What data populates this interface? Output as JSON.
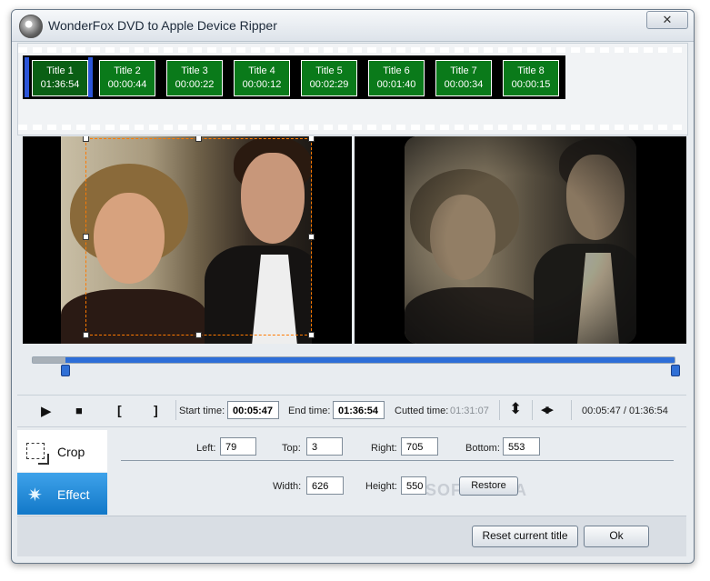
{
  "window": {
    "title": "WonderFox DVD to Apple Device Ripper",
    "close_glyph": "✕"
  },
  "titles": [
    {
      "name": "Title 1",
      "duration": "01:36:54"
    },
    {
      "name": "Title 2",
      "duration": "00:00:44"
    },
    {
      "name": "Title 3",
      "duration": "00:00:22"
    },
    {
      "name": "Title 4",
      "duration": "00:00:12"
    },
    {
      "name": "Title 5",
      "duration": "00:02:29"
    },
    {
      "name": "Title 6",
      "duration": "00:01:40"
    },
    {
      "name": "Title 7",
      "duration": "00:00:34"
    },
    {
      "name": "Title 8",
      "duration": "00:00:15"
    }
  ],
  "selected_title_index": 0,
  "controls": {
    "play_glyph": "▶",
    "stop_glyph": "■",
    "mark_in_glyph": "[",
    "mark_out_glyph": "]",
    "start_label": "Start time:",
    "start_value": "00:05:47",
    "end_label": "End time:",
    "end_value": "01:36:54",
    "cutted_label": "Cutted time:",
    "cutted_value": "01:31:07",
    "vertical_flip_glyph": "⬍",
    "horizontal_flip_glyph": "◀▶",
    "position": "00:05:47 / 01:36:54"
  },
  "tabs": {
    "crop": "Crop",
    "effect": "Effect",
    "effect_glyph": "✷"
  },
  "crop": {
    "left_label": "Left:",
    "left": "79",
    "top_label": "Top:",
    "top": "3",
    "right_label": "Right:",
    "right": "705",
    "bottom_label": "Bottom:",
    "bottom": "553",
    "width_label": "Width:",
    "width": "626",
    "height_label": "Height:",
    "height": "550",
    "restore": "Restore"
  },
  "watermark": "SOFTPEDIA",
  "footer": {
    "reset": "Reset current title",
    "ok": "Ok"
  },
  "timeline": {
    "start_fraction": 0.06,
    "end_fraction": 1.0
  },
  "colors": {
    "accent": "#2d6ed8",
    "thumb": "#0a7a1a",
    "crop_box": "#ff7a00",
    "effect_tab": "#1e88d8"
  }
}
